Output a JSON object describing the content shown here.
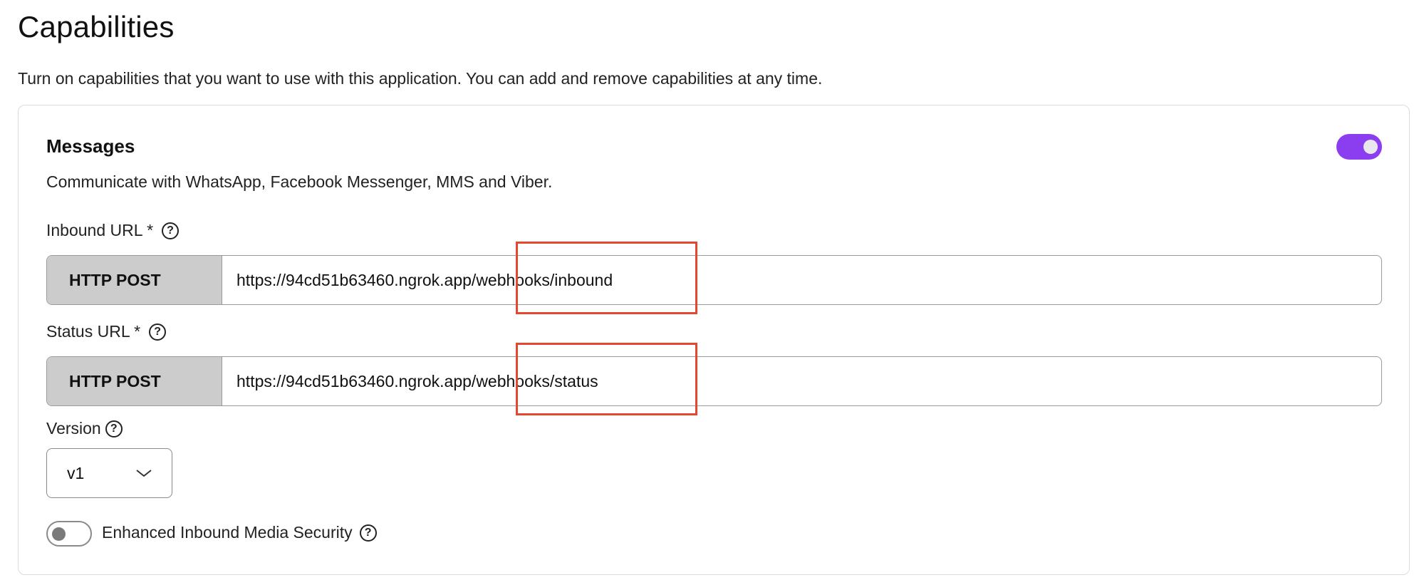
{
  "page": {
    "title": "Capabilities",
    "description": "Turn on capabilities that you want to use with this application. You can add and remove capabilities at any time."
  },
  "capability": {
    "name": "Messages",
    "enabled": true,
    "description": "Communicate with WhatsApp, Facebook Messenger, MMS and Viber.",
    "inbound": {
      "label": "Inbound URL *",
      "method": "HTTP POST",
      "url": "https://94cd51b63460.ngrok.app/webhooks/inbound"
    },
    "status": {
      "label": "Status URL *",
      "method": "HTTP POST",
      "url": "https://94cd51b63460.ngrok.app/webhooks/status"
    },
    "version": {
      "label": "Version",
      "selected": "v1"
    },
    "enhanced_security": {
      "label": "Enhanced Inbound Media Security",
      "enabled": false
    }
  },
  "icons": {
    "help": "?",
    "select_arrow": "chevron-down-icon"
  },
  "colors": {
    "toggle_on": "#8b3df0",
    "highlight": "#e4472e",
    "method_bg": "#cccccc"
  }
}
